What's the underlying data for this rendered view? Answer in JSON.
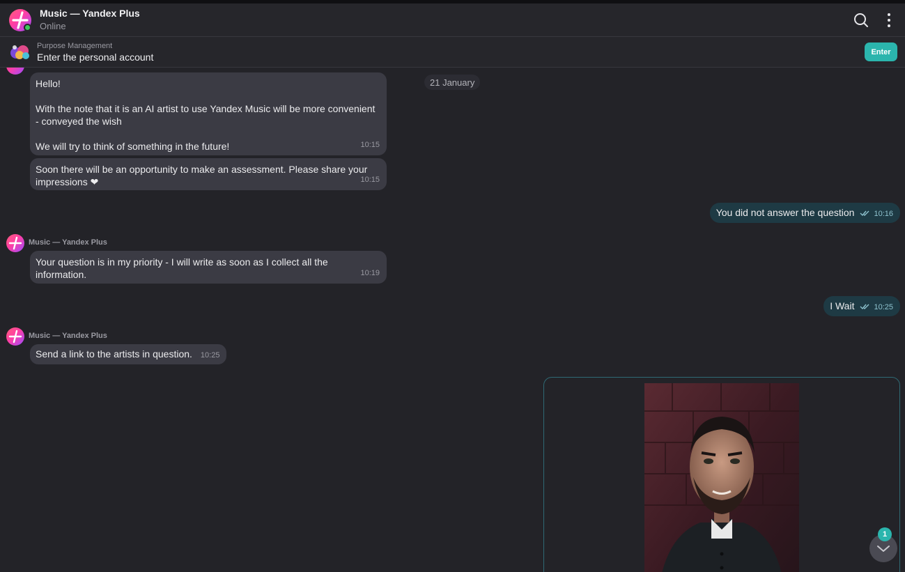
{
  "header": {
    "title": "Music — Yandex Plus",
    "status": "Online",
    "icons": [
      "search-icon",
      "more-vertical-icon"
    ]
  },
  "pinned": {
    "label": "Purpose Management",
    "text": "Enter the personal account",
    "button": "Enter"
  },
  "chat": {
    "date": "21 January",
    "messages": [
      {
        "direction": "in",
        "lines": [
          "Hello!",
          "",
          "With the note that it is an AI artist to use Yandex Music will be more convenient",
          "- conveyed the wish",
          "",
          "We will try to think of something in the future!"
        ],
        "time": "10:15"
      },
      {
        "direction": "in",
        "lines": [
          "Soon there will be an opportunity to make an assessment. Please share your",
          "impressions ❤"
        ],
        "time": "10:15"
      },
      {
        "direction": "out",
        "text": "You did not answer the question",
        "time": "10:16"
      },
      {
        "direction": "in",
        "sender": "Music — Yandex Plus",
        "lines": [
          "Your question is in my priority - I will write as soon as I collect all the",
          "information."
        ],
        "time": "10:19"
      },
      {
        "direction": "out",
        "text": "I Wait",
        "time": "10:25"
      },
      {
        "direction": "in",
        "sender": "Music — Yandex Plus",
        "text": "Send a link to the artists in question.",
        "time": "10:25"
      },
      {
        "direction": "out",
        "type": "image"
      }
    ]
  },
  "scroll": {
    "unread_count": "1"
  },
  "colors": {
    "background": "#232328",
    "incoming_bubble": "#3b3b44",
    "outgoing_bubble": "#1e3a44",
    "accent": "#2bb5ad"
  }
}
